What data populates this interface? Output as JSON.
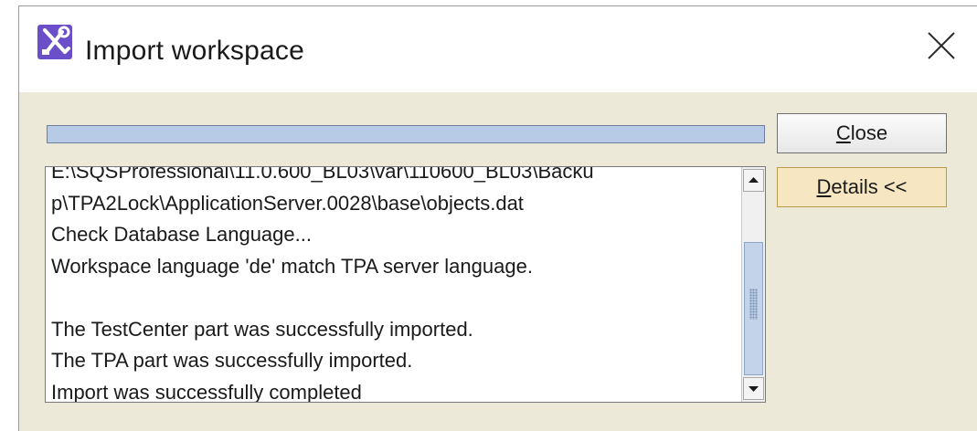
{
  "window": {
    "title": "Import workspace",
    "icon": "tools-icon",
    "close_icon": "close-icon"
  },
  "progress": {
    "value_fraction": 1.0
  },
  "log": {
    "lines": [
      "E:\\SQSProfessional\\11.0.600_BL03\\var\\110600_BL03\\Backu",
      "p\\TPA2Lock\\ApplicationServer.0028\\base\\objects.dat",
      "Check Database Language...",
      "Workspace language 'de' match TPA server language.",
      "",
      "The TestCenter part was successfully imported.",
      "The TPA part was successfully imported.",
      "Import was successfully completed"
    ]
  },
  "buttons": {
    "close": {
      "mnemonic": "C",
      "rest": "lose"
    },
    "details": {
      "mnemonic": "D",
      "rest": "etails <<"
    }
  },
  "colors": {
    "dialog_bg": "#ece9d8",
    "progress_fill": "#b7cbe6",
    "icon_bg": "#6a4fc9"
  }
}
